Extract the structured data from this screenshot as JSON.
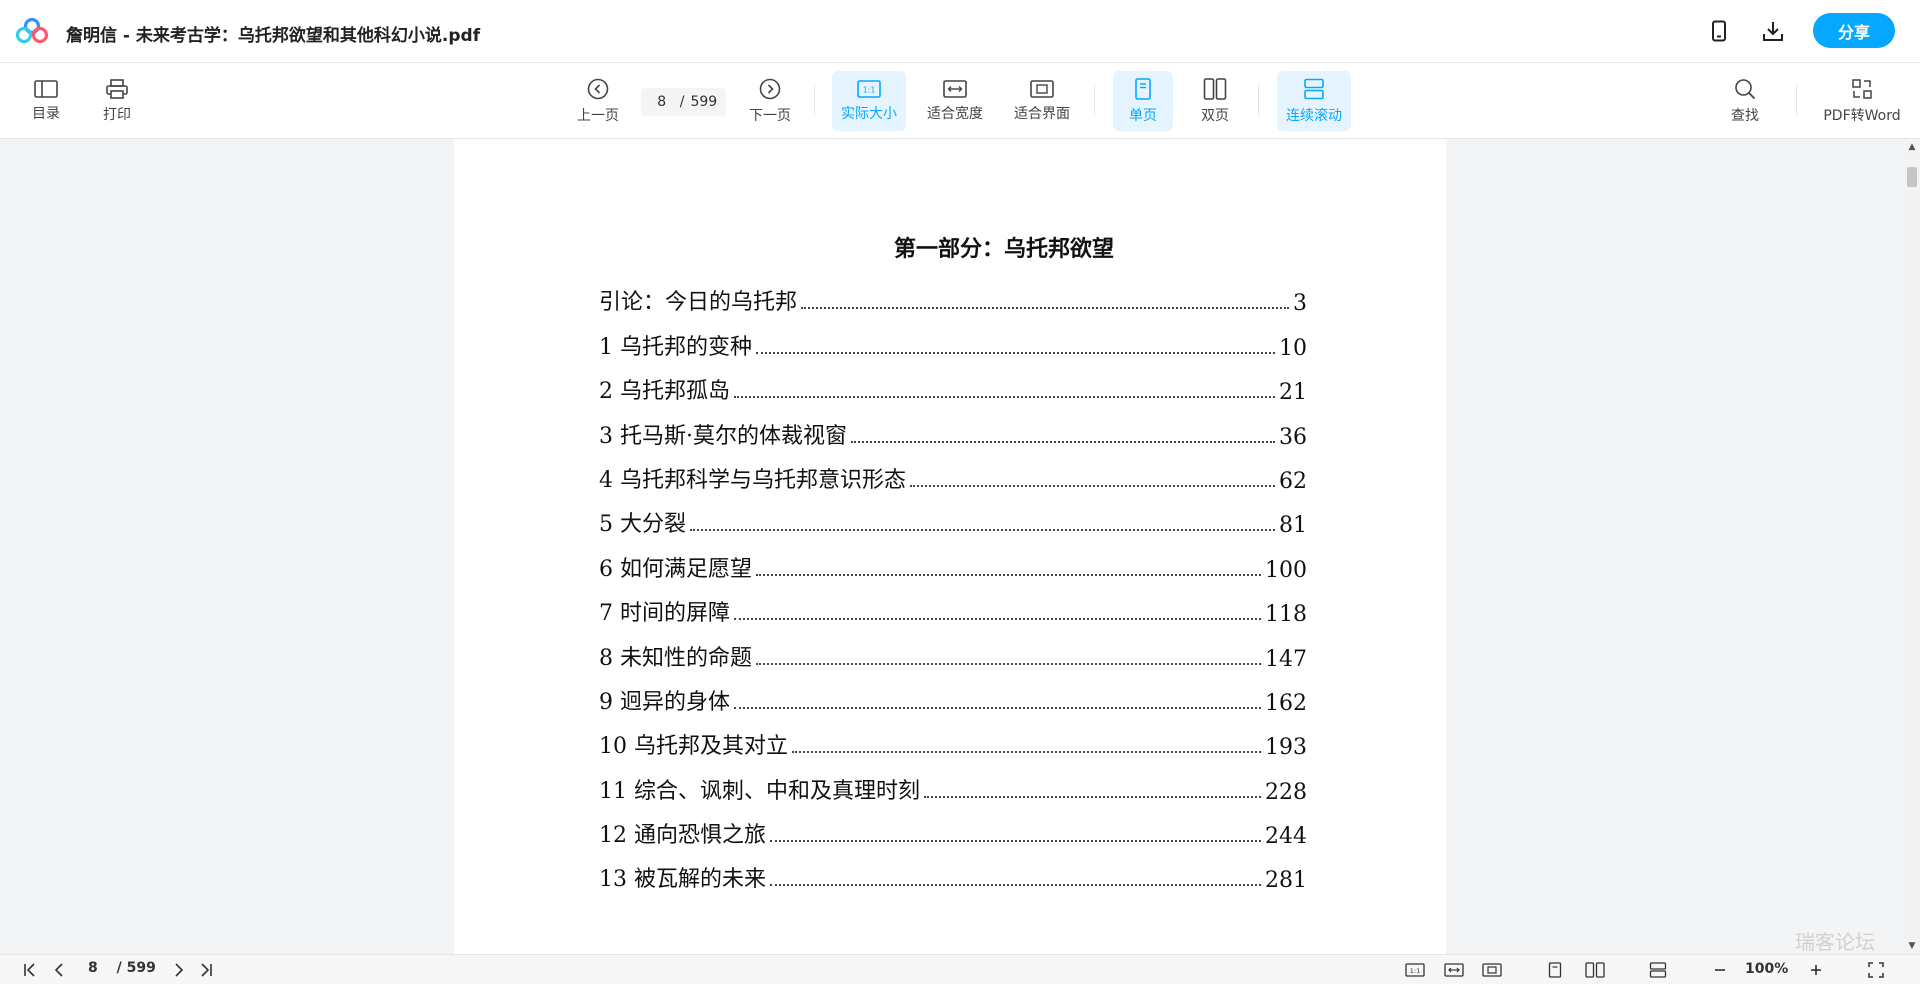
{
  "window": {
    "title": "詹明信 - 未来考古学：乌托邦欲望和其他科幻小说.pdf",
    "share_label": "分享",
    "phone_icon": "phone-icon",
    "download_icon": "download-icon",
    "accent_color": "#06a7ff"
  },
  "toolbar": {
    "toc_label": "目录",
    "print_label": "打印",
    "prev_label": "上一页",
    "next_label": "下一页",
    "current_page": "8",
    "page_sep": "/",
    "total_pages": "599",
    "actual_size_label": "实际大小",
    "fit_width_label": "适合宽度",
    "fit_page_label": "适合界面",
    "single_page_label": "单页",
    "double_page_label": "双页",
    "continuous_label": "连续滚动",
    "search_label": "查找",
    "pdf_to_word_label": "PDF转Word"
  },
  "document": {
    "section_title": "第一部分：乌托邦欲望",
    "toc_entries": [
      {
        "title": "引论：今日的乌托邦",
        "page": "3"
      },
      {
        "title": "1 乌托邦的变种",
        "page": "10"
      },
      {
        "title": "2 乌托邦孤岛",
        "page": "21"
      },
      {
        "title": "3 托马斯·莫尔的体裁视窗",
        "page": "36"
      },
      {
        "title": "4 乌托邦科学与乌托邦意识形态",
        "page": "62"
      },
      {
        "title": "5 大分裂",
        "page": "81"
      },
      {
        "title": "6 如何满足愿望",
        "page": "100"
      },
      {
        "title": "7 时间的屏障",
        "page": "118"
      },
      {
        "title": "8 未知性的命题",
        "page": "147"
      },
      {
        "title": "9 迥异的身体",
        "page": "162"
      },
      {
        "title": "10 乌托邦及其对立",
        "page": "193"
      },
      {
        "title": "11 综合、讽刺、中和及真理时刻",
        "page": "228"
      },
      {
        "title": "12 通向恐惧之旅",
        "page": "244"
      },
      {
        "title": "13 被瓦解的未来",
        "page": "281"
      }
    ]
  },
  "statusbar": {
    "current_page": "8",
    "total_pages": "/ 599",
    "zoom": "100%"
  },
  "watermark": "瑞客论坛"
}
